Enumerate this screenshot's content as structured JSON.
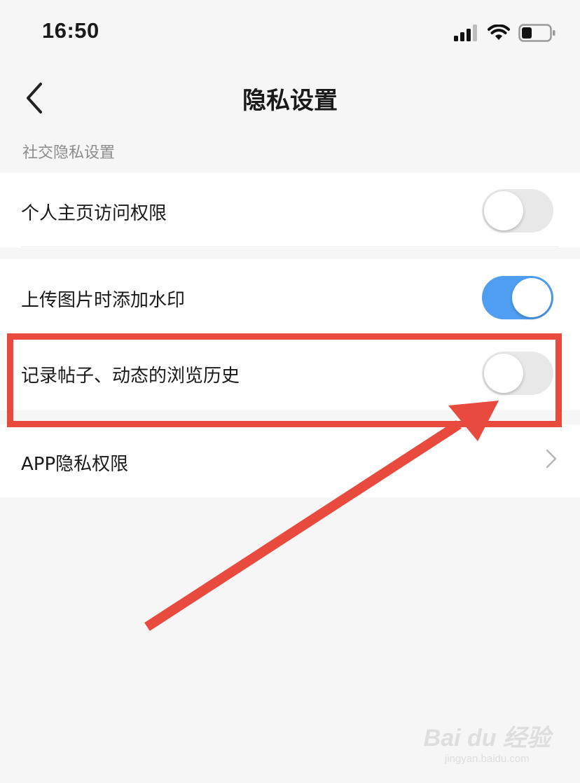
{
  "status_bar": {
    "time": "16:50",
    "icons": [
      "signal-icon",
      "wifi-icon",
      "battery-icon"
    ]
  },
  "nav": {
    "title": "隐私设置",
    "back_icon": "chevron-left-icon"
  },
  "section": {
    "header": "社交隐私设置"
  },
  "settings": [
    {
      "label": "个人主页访问权限",
      "control": "toggle",
      "state": "off"
    },
    {
      "label": "上传图片时添加水印",
      "control": "toggle",
      "state": "on"
    },
    {
      "label": "记录帖子、动态的浏览历史",
      "control": "toggle",
      "state": "off"
    },
    {
      "label": "APP隐私权限",
      "control": "chevron",
      "icon": "chevron-right-icon"
    }
  ],
  "annotation": {
    "highlight_color": "#e84a3e",
    "arrow_icon": "arrow-icon"
  },
  "colors": {
    "toggle_on": "#4f9ef2",
    "toggle_off": "#e8e8e8",
    "background": "#f6f6f6"
  },
  "watermark": {
    "main": "Bai du 经验",
    "sub": "jingyan.baidu.com"
  }
}
